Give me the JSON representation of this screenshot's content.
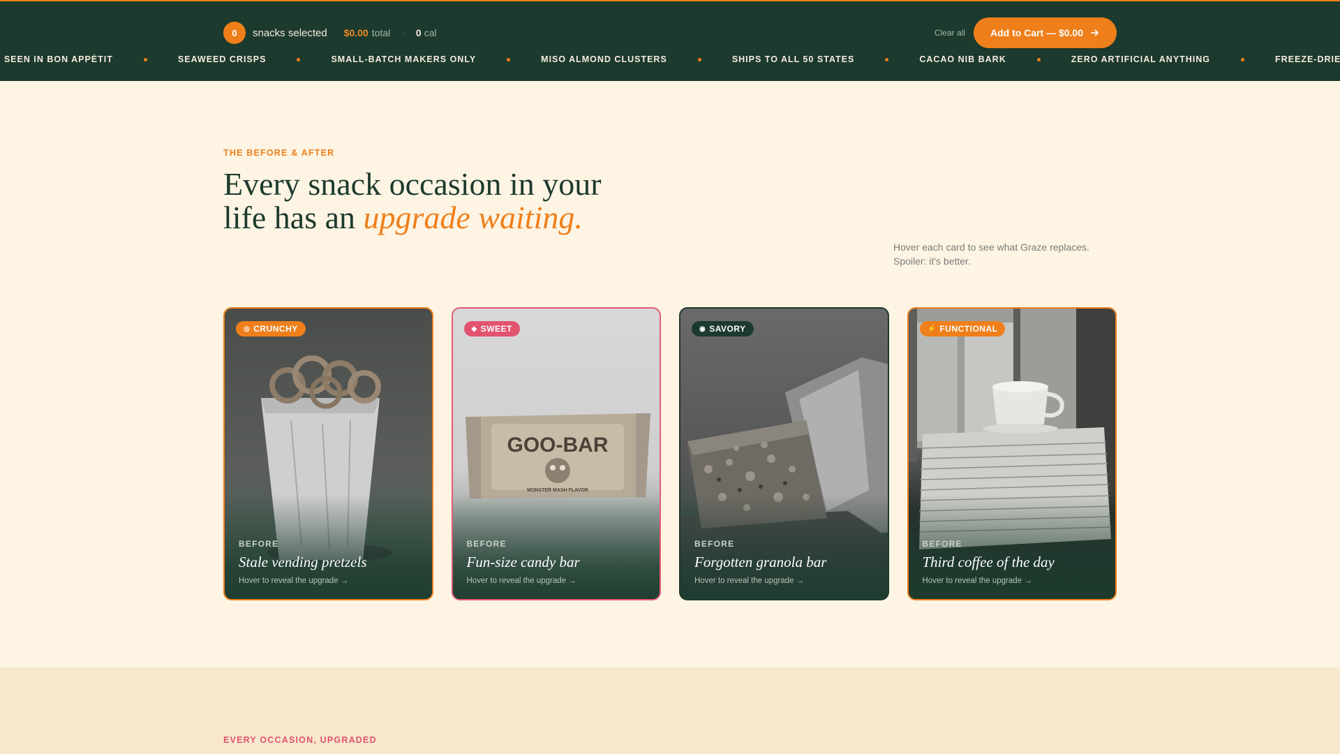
{
  "topbar": {
    "count": "0",
    "selected_label": "snacks selected",
    "total_value": "$0.00",
    "total_label": "total",
    "separator": "·",
    "cal_value": "0",
    "cal_label": "cal",
    "clear_all": "Clear all",
    "cart_label": "Add to Cart — $0.00",
    "accent_color": "#ef7f1a",
    "bg_color": "#1c3a2d"
  },
  "ticker": [
    "As seen in Bon Appétit",
    "Seaweed crisps",
    "Small-batch makers only",
    "Miso almond clusters",
    "Ships to all 50 states",
    "Cacao nib bark",
    "Zero artificial anything",
    "Freeze-dried m"
  ],
  "section1": {
    "eyebrow": "THE BEFORE & AFTER",
    "headline_part1": "Every snack occasion in your life has an ",
    "headline_accent": "upgrade waiting.",
    "hint_line1": "Hover each card to see what Graze replaces.",
    "hint_line2": "Spoiler: it's better."
  },
  "cards": [
    {
      "tag": "CRUNCHY",
      "tag_icon": "pretzel-icon",
      "before": "BEFORE",
      "title": "Stale vending pretzels",
      "reveal": "Hover to reveal the upgrade →"
    },
    {
      "tag": "SWEET",
      "tag_icon": "candy-icon",
      "before": "BEFORE",
      "title": "Fun-size candy bar",
      "reveal": "Hover to reveal the upgrade →",
      "wrapper_text": "GOO-BAR",
      "wrapper_sub": "MONSTER MASH FLAVOR"
    },
    {
      "tag": "SAVORY",
      "tag_icon": "savory-icon",
      "before": "BEFORE",
      "title": "Forgotten granola bar",
      "reveal": "Hover to reveal the upgrade →"
    },
    {
      "tag": "FUNCTIONAL",
      "tag_icon": "lightning-icon",
      "before": "BEFORE",
      "title": "Third coffee of the day",
      "reveal": "Hover to reveal the upgrade →"
    }
  ],
  "section2": {
    "eyebrow": "EVERY OCCASION, UPGRADED"
  }
}
